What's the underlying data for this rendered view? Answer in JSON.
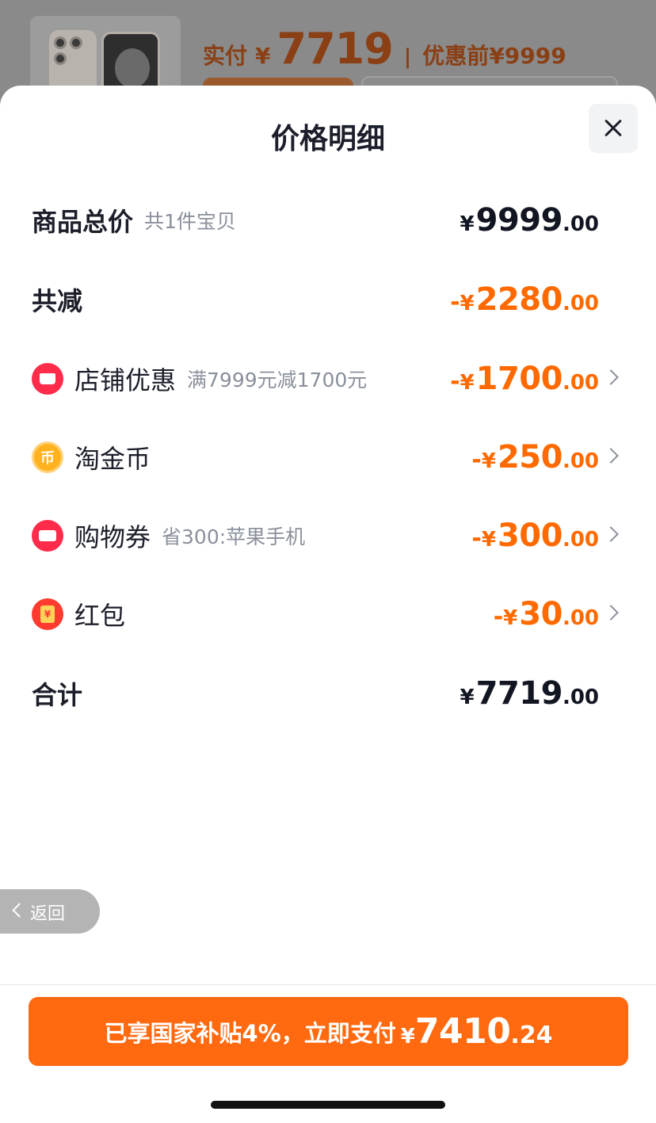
{
  "header": {
    "paid_label": "实付",
    "paid_currency": "¥",
    "paid_amount": "7719",
    "separator": "|",
    "original_price": "优惠前¥9999"
  },
  "sheet": {
    "title": "价格明细"
  },
  "rows": {
    "total": {
      "title": "商品总价",
      "sub": "共1件宝贝",
      "sign": "",
      "currency": "¥",
      "int": "9999",
      "dec": ".00"
    },
    "discount_total": {
      "title": "共减",
      "sign": "-",
      "currency": "¥",
      "int": "2280",
      "dec": ".00"
    },
    "store_discount": {
      "title": "店铺优惠",
      "sub": "满7999元减1700元",
      "sign": "-",
      "currency": "¥",
      "int": "1700",
      "dec": ".00",
      "icon": "store-icon"
    },
    "gold_coin": {
      "title": "淘金币",
      "sign": "-",
      "currency": "¥",
      "int": "250",
      "dec": ".00",
      "icon": "coin-icon",
      "icon_glyph": "币"
    },
    "coupon": {
      "title": "购物券",
      "sub": "省300:苹果手机",
      "sign": "-",
      "currency": "¥",
      "int": "300",
      "dec": ".00",
      "icon": "coupon-icon"
    },
    "red_packet": {
      "title": "红包",
      "sign": "-",
      "currency": "¥",
      "int": "30",
      "dec": ".00",
      "icon": "red-packet-icon"
    },
    "subtotal": {
      "title": "合计",
      "sign": "",
      "currency": "¥",
      "int": "7719",
      "dec": ".00"
    }
  },
  "back": {
    "label": "返回"
  },
  "pay": {
    "message": "已享国家补贴4%，立即支付",
    "currency": "¥",
    "int": "7410",
    "dec": ".24"
  },
  "colors": {
    "accent": "#ff6a10",
    "discount": "#ff6a00",
    "text_dark": "#1c1f2a",
    "text_muted": "#8a909c"
  }
}
